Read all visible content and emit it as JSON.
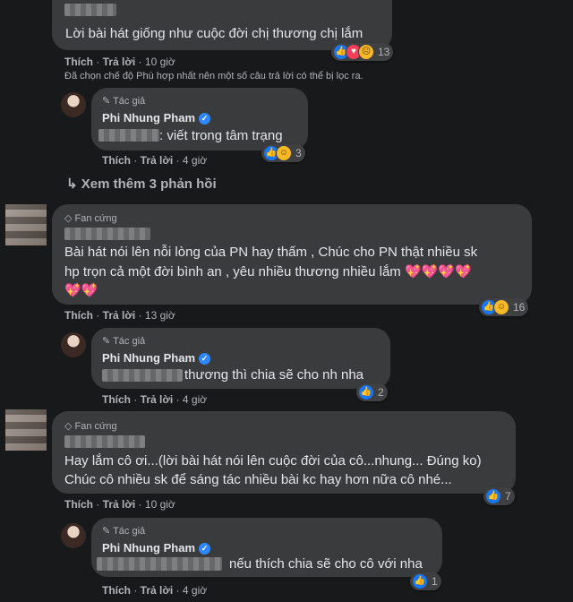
{
  "labels": {
    "like": "Thích",
    "reply": "Trả lời",
    "author_badge": "Tác giả",
    "fan_badge": "Fan cứng",
    "author_name": "Phi Nhung Pham",
    "filter_notice": "Đã chọn chế độ Phù hợp nhất nên một số câu trả lời có thể bị lọc ra.",
    "see_more": "Xem thêm 3 phản hồi"
  },
  "comments": [
    {
      "text": "Lời bài hát giống như cuộc đời chị thương chị lắm",
      "time": "10 giờ",
      "reactions": "13",
      "reply": {
        "text": ": viết trong tâm trạng",
        "time": "4 giờ",
        "reactions": "3"
      }
    },
    {
      "text_line1": "Bài hát nói lên nỗi lòng của PN hay thấm , Chúc cho PN thật nhiều sk",
      "text_line2": "hp trọn cả một đời bình an , yêu nhiều thương nhiều lắm 💖💖💖💖",
      "text_line3": "💖💖",
      "time": "13 giờ",
      "reactions": "16",
      "reply": {
        "text": "thương thì chia sẽ cho nh nha",
        "time": "4 giờ",
        "reactions": "2"
      }
    },
    {
      "text_line1": "Hay lắm cô ơi...(lời bài hát nói lên cuộc đời của cô...nhung... Đúng ko)",
      "text_line2": "Chúc cô nhiều sk để sáng tác nhiều bài kc hay hơn nữa cô nhé...",
      "time": "10 giờ",
      "reactions": "7",
      "reply": {
        "text": "nếu thích chia sẽ cho cô với nha",
        "time": "4 giờ",
        "reactions": "1"
      }
    }
  ]
}
